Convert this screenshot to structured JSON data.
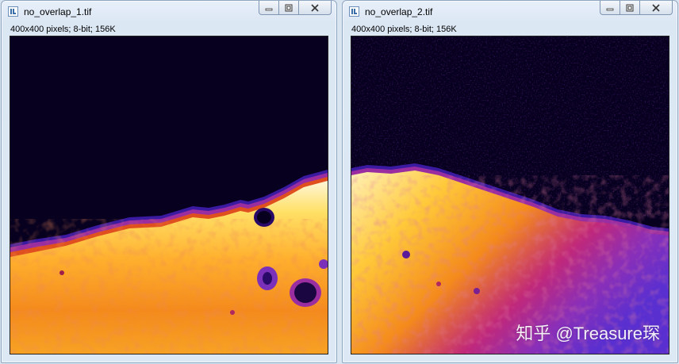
{
  "windows": [
    {
      "title": "no_overlap_1.tif",
      "info": "400x400 pixels; 8-bit; 156K",
      "icon": "imagej-window-icon",
      "controls": [
        "minimize-icon",
        "restore-icon",
        "close-icon"
      ]
    },
    {
      "title": "no_overlap_2.tif",
      "info": "400x400 pixels; 8-bit; 156K",
      "icon": "imagej-window-icon",
      "controls": [
        "minimize-icon",
        "restore-icon",
        "close-icon"
      ]
    }
  ],
  "watermark": "知乎 @Treasure琛",
  "colors": {
    "lut": "fire",
    "background_dark": "#07001f",
    "hot_white": "#fff6d8",
    "yellow": "#ffd23c",
    "orange": "#f48a1c",
    "magenta": "#9a2ea0",
    "blue": "#5a2fd0"
  }
}
